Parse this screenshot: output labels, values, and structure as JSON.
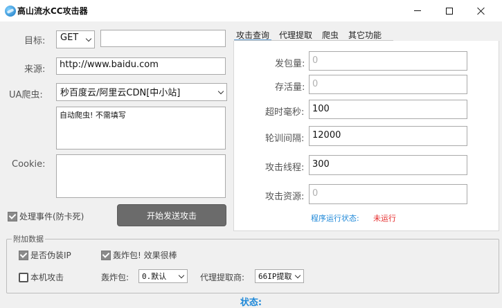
{
  "window": {
    "title": "高山流水CC攻击器"
  },
  "form": {
    "target_label": "目标:",
    "method_value": "GET",
    "target_value": "",
    "referer_label": "来源:",
    "referer_value": "http://www.baidu.com",
    "ua_label": "UA爬虫:",
    "ua_value": "秒百度云/阿里云CDN[中小站]",
    "ua_note": "自动爬虫! 不需填写",
    "cookie_label": "Cookie:",
    "cookie_value": "",
    "handle_events_label": "处理事件(防卡死)",
    "handle_events_checked": true,
    "start_button": "开始发送攻击"
  },
  "tabs": [
    {
      "label": "攻击查询",
      "active": true
    },
    {
      "label": "代理提取",
      "active": false
    },
    {
      "label": "爬虫",
      "active": false
    },
    {
      "label": "其它功能",
      "active": false
    }
  ],
  "panel": {
    "fields": [
      {
        "label": "发包量:",
        "value": "0",
        "disabled": true
      },
      {
        "label": "存活量:",
        "value": "0",
        "disabled": true
      },
      {
        "label": "超时毫秒:",
        "value": "100",
        "disabled": false
      },
      {
        "label": "轮训间隔:",
        "value": "12000",
        "disabled": false
      },
      {
        "label": "攻击线程:",
        "value": "300",
        "disabled": false
      },
      {
        "label": "攻击资源:",
        "value": "0",
        "disabled": true
      }
    ],
    "status_label": "程序运行状态:",
    "status_value": "未运行",
    "status_value_color": "#e52b2b"
  },
  "extra": {
    "group_title": "附加数据",
    "fake_ip_label": "是否伪装IP",
    "fake_ip_checked": true,
    "bomb_label": "轰炸包! 效果很棒",
    "bomb_checked": true,
    "local_attack_label": "本机攻击",
    "local_attack_checked": false,
    "bomb_pack_label": "轰炸包:",
    "bomb_pack_value": "0.默认",
    "proxy_label": "代理提取商:",
    "proxy_value": "66IP提取"
  },
  "footer": {
    "status_label": "状态:"
  },
  "colors": {
    "accent": "#1e88d8",
    "button": "#6b6b6b"
  }
}
